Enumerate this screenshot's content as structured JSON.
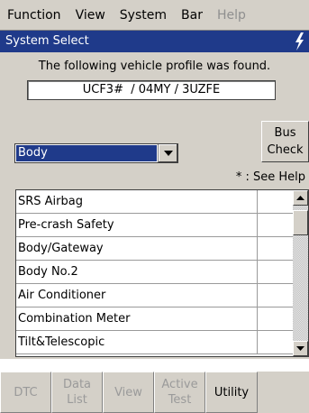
{
  "menu": {
    "items": [
      {
        "label": "Function",
        "disabled": false
      },
      {
        "label": "View",
        "disabled": false
      },
      {
        "label": "System",
        "disabled": false
      },
      {
        "label": "Bar",
        "disabled": false
      },
      {
        "label": "Help",
        "disabled": true
      }
    ]
  },
  "window": {
    "title": "System Select"
  },
  "profile": {
    "message": "The following vehicle profile was found.",
    "value": "UCF3#  / 04MY / 3UZFE"
  },
  "system_select": {
    "selected": "Body"
  },
  "bus_check": {
    "label_line1": "Bus",
    "label_line2": "Check"
  },
  "help_note": "* : See Help",
  "systems": [
    "SRS Airbag",
    "Pre-crash Safety",
    "Body/Gateway",
    "Body No.2",
    "Air Conditioner",
    "Combination Meter",
    "Tilt&Telescopic"
  ],
  "bottom_buttons": [
    {
      "label": "DTC",
      "enabled": false
    },
    {
      "label": "Data\nList",
      "enabled": false
    },
    {
      "label": "View",
      "enabled": false
    },
    {
      "label": "Active\nTest",
      "enabled": false
    },
    {
      "label": "Utility",
      "enabled": true
    }
  ],
  "colors": {
    "title_bar": "#1f3a8a",
    "panel": "#d4d0c8",
    "disabled_text": "#9a9a9a"
  }
}
